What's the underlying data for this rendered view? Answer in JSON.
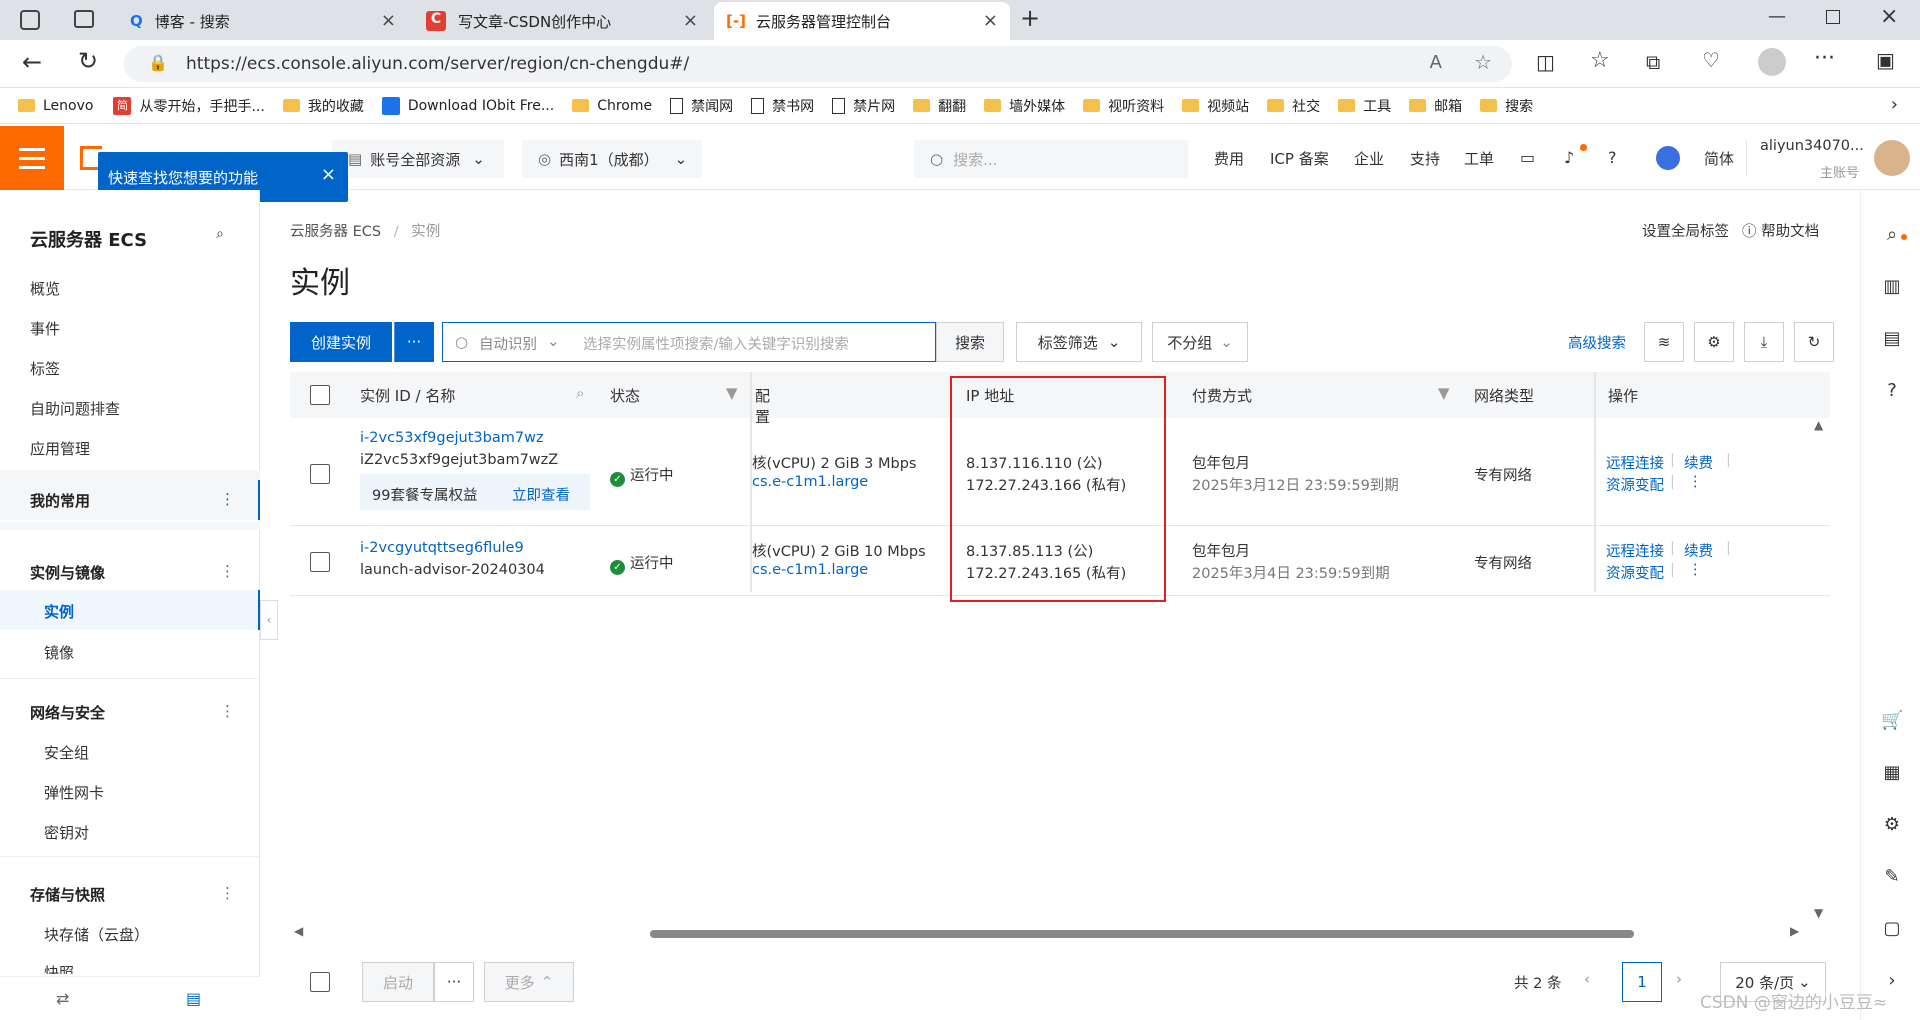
{
  "browser": {
    "tabs": [
      {
        "title": "博客 - 搜索"
      },
      {
        "title": "写文章-CSDN创作中心"
      },
      {
        "title": "云服务器管理控制台"
      }
    ],
    "url": "https://ecs.console.aliyun.com/server/region/cn-chengdu#/",
    "bookmarks": [
      "Lenovo",
      "从零开始，手把手...",
      "我的收藏",
      "Download IObit Fre...",
      "Chrome",
      "禁闻网",
      "禁书网",
      "禁片网",
      "翻翻",
      "墙外媒体",
      "视听资料",
      "视频站",
      "社交",
      "工具",
      "邮箱",
      "搜索"
    ]
  },
  "topnav": {
    "account_resources": "账号全部资源",
    "region": "西南1（成都）",
    "search_placeholder": "搜索...",
    "links": [
      "费用",
      "ICP 备案",
      "企业",
      "支持",
      "工单"
    ],
    "lang": "简体",
    "username": "aliyun34070...",
    "account_type": "主账号",
    "tooltip": "快速查找您想要的功能"
  },
  "sidebar": {
    "title": "云服务器 ECS",
    "items": [
      "概览",
      "事件",
      "标签",
      "自助问题排查",
      "应用管理"
    ],
    "favorites": "我的常用",
    "group1": {
      "title": "实例与镜像",
      "items": [
        "实例",
        "镜像"
      ]
    },
    "group2": {
      "title": "网络与安全",
      "items": [
        "安全组",
        "弹性网卡",
        "密钥对"
      ]
    },
    "group3": {
      "title": "存储与快照",
      "items": [
        "块存储（云盘）",
        "快照"
      ]
    }
  },
  "main": {
    "breadcrumb": [
      "云服务器 ECS",
      "/",
      "实例"
    ],
    "page_title": "实例",
    "global_tags": "设置全局标签",
    "help_docs": "帮助文档",
    "create_button": "创建实例",
    "more_button": "···",
    "search_mode": "自动识别",
    "search_placeholder": "选择实例属性项搜索/输入关键字识别搜索",
    "search_button": "搜索",
    "tag_filter": "标签筛选",
    "group_by": "不分组",
    "advanced_search": "高级搜索",
    "columns": [
      "实例 ID / 名称",
      "状态",
      "配置",
      "IP 地址",
      "付费方式",
      "网络类型",
      "操作"
    ],
    "rows": [
      {
        "id": "i-2vc53xf9gejut3bam7wz",
        "name": "iZ2vc53xf9gejut3bam7wzZ",
        "promo": "99套餐专属权益",
        "promo_link": "立即查看",
        "status": "运行中",
        "config_line1": "核(vCPU)  2 GiB 3 Mbps",
        "config_line2": "cs.e-c1m1.large",
        "ip_public": "8.137.116.110 (公)",
        "ip_private": "172.27.243.166 (私有)",
        "billing": "包年包月",
        "expiry": "2025年3月12日 23:59:59到期",
        "network": "专有网络",
        "action1": "远程连接",
        "action2": "续费",
        "action3": "资源变配"
      },
      {
        "id": "i-2vcgyutqttseg6flule9",
        "name": "launch-advisor-20240304",
        "promo": "",
        "promo_link": "",
        "status": "运行中",
        "config_line1": "核(vCPU)  2 GiB 10 Mbps",
        "config_line2": "cs.e-c1m1.large",
        "ip_public": "8.137.85.113 (公)",
        "ip_private": "172.27.243.165 (私有)",
        "billing": "包年包月",
        "expiry": "2025年3月4日 23:59:59到期",
        "network": "专有网络",
        "action1": "远程连接",
        "action2": "续费",
        "action3": "资源变配"
      }
    ],
    "footer": {
      "start": "启动",
      "more": "···",
      "more_menu": "更多",
      "total": "共 2 条",
      "page": "1",
      "page_size": "20 条/页"
    },
    "watermark": "CSDN @窗边的小豆豆≈"
  },
  "colors": {
    "brand": "#ff6a00",
    "primary": "#0064c8",
    "highlight": "#e02020"
  }
}
